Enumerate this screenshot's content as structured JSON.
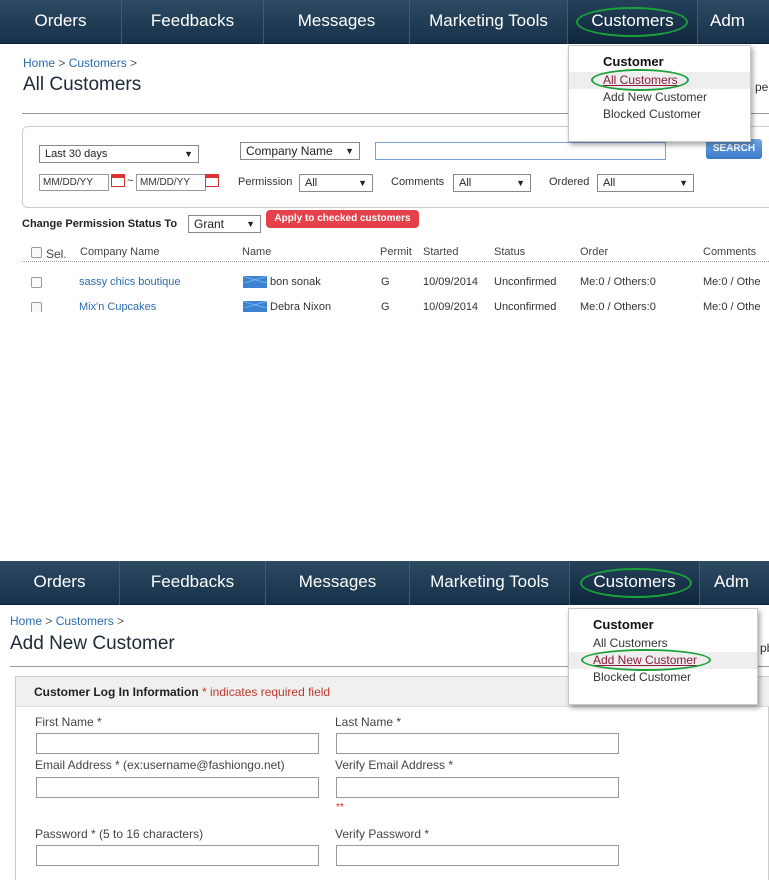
{
  "nav": {
    "items": [
      "Orders",
      "Feedbacks",
      "Messages",
      "Marketing Tools",
      "Customers",
      "Adm"
    ]
  },
  "dropdown": {
    "header": "Customer",
    "items": [
      "All Customers",
      "Add New Customer",
      "Blocked Customer"
    ]
  },
  "panel1": {
    "breadcrumb": {
      "home": "Home",
      "sep1": " > ",
      "section": "Customers",
      "sep2": " >"
    },
    "title": "All Customers",
    "peek": "pe",
    "filters": {
      "date_range": "Last 30 days",
      "search_by": "Company Name",
      "search_value": "",
      "search_button": "SEARCH",
      "date_placeholder": "MM/DD/YY",
      "date_sep": "~",
      "permission_label": "Permission",
      "permission_value": "All",
      "comments_label": "Comments",
      "comments_value": "All",
      "ordered_label": "Ordered",
      "ordered_value": "All"
    },
    "permission_change": {
      "label": "Change Permission Status To",
      "value": "Grant",
      "apply_button": "Apply to checked customers"
    },
    "table": {
      "columns": [
        "Sel.",
        "Company Name",
        "Name",
        "Permit",
        "Started",
        "Status",
        "Order",
        "Comments"
      ],
      "rows": [
        {
          "company": "sassy chics boutique",
          "name": "bon sonak",
          "permit": "G",
          "started": "10/09/2014",
          "status": "Unconfirmed",
          "order": "Me:0 / Others:0",
          "comments": "Me:0 / Othe"
        },
        {
          "company": "Mix'n Cupcakes",
          "name": "Debra Nixon",
          "permit": "G",
          "started": "10/09/2014",
          "status": "Unconfirmed",
          "order": "Me:0 / Others:0",
          "comments": "Me:0 / Othe"
        }
      ]
    }
  },
  "panel2": {
    "breadcrumb": {
      "home": "Home",
      "sep1": " > ",
      "section": "Customers",
      "sep2": " >"
    },
    "title": "Add New Customer",
    "peek": "pb",
    "form": {
      "section_title": "Customer Log In Information",
      "required_note": "* indicates required field",
      "first_name_label": "First Name *",
      "last_name_label": "Last Name *",
      "email_label": "Email Address * (ex:username@fashiongo.net)",
      "verify_email_label": "Verify Email Address *",
      "error_mark": "**",
      "password_label": "Password * (5 to 16 characters)",
      "verify_password_label": "Verify Password *"
    }
  },
  "colors": {
    "nav_bg": "#1f3a52",
    "highlight_oval": "#1aa23a",
    "link": "#2b6cb0",
    "apply_button": "#e4414a"
  }
}
